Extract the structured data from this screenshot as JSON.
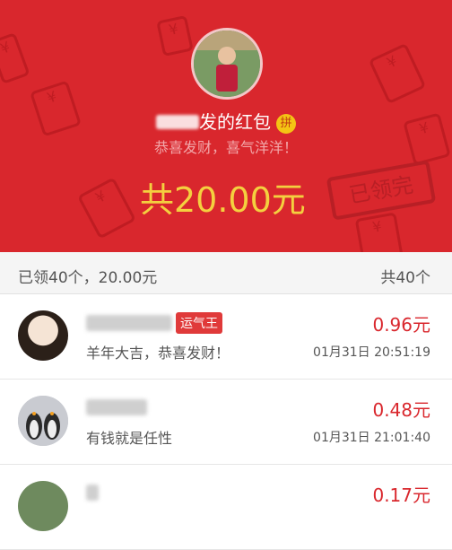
{
  "header": {
    "title_suffix": "发的红包",
    "pin_badge": "拼",
    "subtitle": "恭喜发财，喜气洋洋！",
    "total_amount": "共20.00元",
    "stamp": "已领完",
    "deco_icon": "¥"
  },
  "summary": {
    "left": "已领40个，20.00元",
    "right": "共40个"
  },
  "records": [
    {
      "message": "羊年大吉，恭喜发财！",
      "amount": "0.96元",
      "time": "01月31日 20:51:19",
      "badge": "运气王"
    },
    {
      "message": "有钱就是任性",
      "amount": "0.48元",
      "time": "01月31日 21:01:40"
    },
    {
      "message": "",
      "amount": "0.17元",
      "time": ""
    }
  ],
  "colors": {
    "accent": "#d9272d",
    "gold": "#f4d03f"
  }
}
